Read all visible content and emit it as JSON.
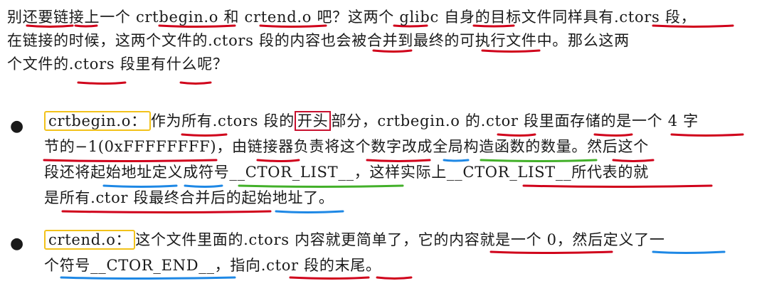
{
  "intro": {
    "line1": "别还要链接上一个 crtbegin.o 和 crtend.o 吧？这两个 glibc 自身的目标文件同样具有.ctors 段，",
    "line2": "在链接的时候，这两个文件的.ctors 段的内容也会被合并到最终的可执行文件中。那么这两",
    "line3": "个文件的.ctors 段里有什么呢？"
  },
  "bullets": [
    {
      "symbol": "●",
      "term": "crtbegin.o：",
      "line1_a": "作为所有.ctors 段的",
      "line1_box": "开头",
      "line1_b": "部分，crtbegin.o 的.ctor 段里面存储的是一个 4 字",
      "line2": "节的−1(0xFFFFFFFF)，由链接器负责将这个数字改成全局构造函数的数量。然后这个",
      "line3": "段还将起始地址定义成符号__CTOR_LIST__，这样实际上__CTOR_LIST__所代表的就",
      "line4": "是所有.ctor 段最终合并后的起始地址了。"
    },
    {
      "symbol": "●",
      "term": "crtend.o：",
      "line1": "这个文件里面的.ctors 内容就更简单了，它的内容就是一个 0，然后定义了一",
      "line2": "个符号__CTOR_END__，指向.ctor 段的末尾。"
    }
  ],
  "annotation_colors": {
    "red": "#d0021b",
    "blue": "#1e88e5",
    "green": "#43b02a",
    "term_box": "#f2c21b"
  }
}
